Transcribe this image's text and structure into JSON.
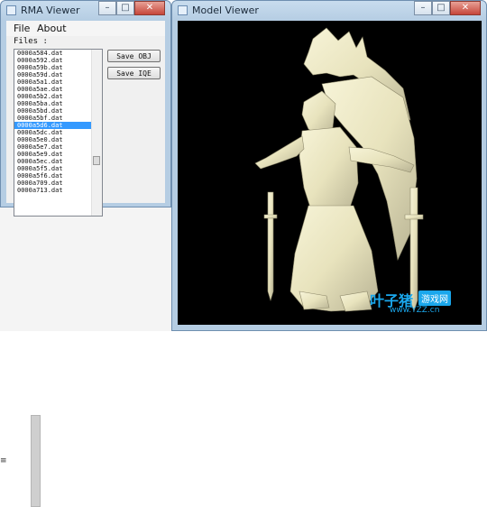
{
  "rma_window": {
    "title": "RMA Viewer",
    "menu": [
      "File",
      "About"
    ],
    "files_label": "Files :",
    "files": [
      "0000a584.dat",
      "0000a592.dat",
      "0000a59b.dat",
      "0000a59d.dat",
      "0000a5a1.dat",
      "0000a5ae.dat",
      "0000a5b2.dat",
      "0000a5ba.dat",
      "0000a5bd.dat",
      "0000a5bf.dat",
      "0000a5d6.dat",
      "0000a5dc.dat",
      "0000a5e0.dat",
      "0000a5e7.dat",
      "0000a5e9.dat",
      "0000a5ec.dat",
      "0000a5f5.dat",
      "0000a5f6.dat",
      "0000a709.dat",
      "0000a713.dat"
    ],
    "selected_file": "0000a5d6.dat",
    "save_obj_label": "Save OBJ",
    "save_iqe_label": "Save IQE"
  },
  "model_window": {
    "title": "Model Viewer"
  },
  "window_buttons": {
    "minimize": "–",
    "maximize": "□",
    "close": "✕"
  },
  "watermark": {
    "logo": "叶子猪",
    "badge": "游戏网",
    "url": "www.YZZ.cn"
  },
  "colors": {
    "list_selection": "#3399ff",
    "model_fill": "#ece8c4",
    "viewport_bg": "#000000",
    "watermark": "#1aa7ec"
  },
  "icons": [
    "window-icon",
    "minimize-icon",
    "maximize-icon",
    "close-icon"
  ]
}
